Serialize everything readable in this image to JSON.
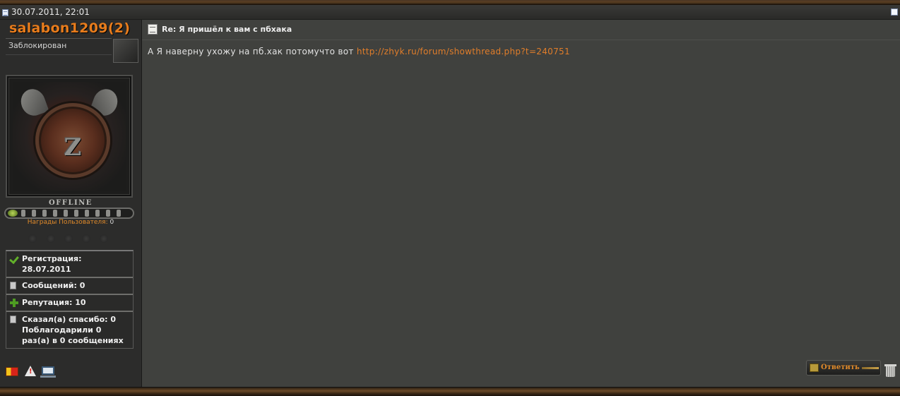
{
  "post": {
    "date": "30.07.2011, 22:01",
    "title": "Re: Я пришёл к вам с пбхака",
    "body_text": "А Я наверну ухожу на пб.хак потомучто вот ",
    "body_link": "http://zhyk.ru/forum/showthread.php?t=240751",
    "reply_label": "Ответить"
  },
  "user": {
    "name": "salabon1209(2)",
    "title": "Заблокирован",
    "avatar_letter": "Z",
    "status": "OFFLINE",
    "awards_label": "Награды Пользователя:",
    "awards_count": "0",
    "stats": {
      "registration": "Регистрация: 28.07.2011",
      "messages": "Сообщений: 0",
      "reputation": "Репутация: 10",
      "thanks": "Сказал(а) спасибо: 0 Поблагодарили 0 раз(а) в 0 сообщениях"
    }
  },
  "icons": {
    "post_icon": "document-icon",
    "select": "checkbox-icon",
    "check": "check-icon",
    "doc": "document-icon",
    "plus": "plus-icon",
    "card": "yellow-red-card-icon",
    "warning": "warning-icon",
    "ip": "computer-icon",
    "trash": "trash-icon"
  },
  "colors": {
    "username": "#e87c1c",
    "link": "#e07d2a",
    "content_bg": "#40413e",
    "panel_bg": "#2c2c2b"
  }
}
